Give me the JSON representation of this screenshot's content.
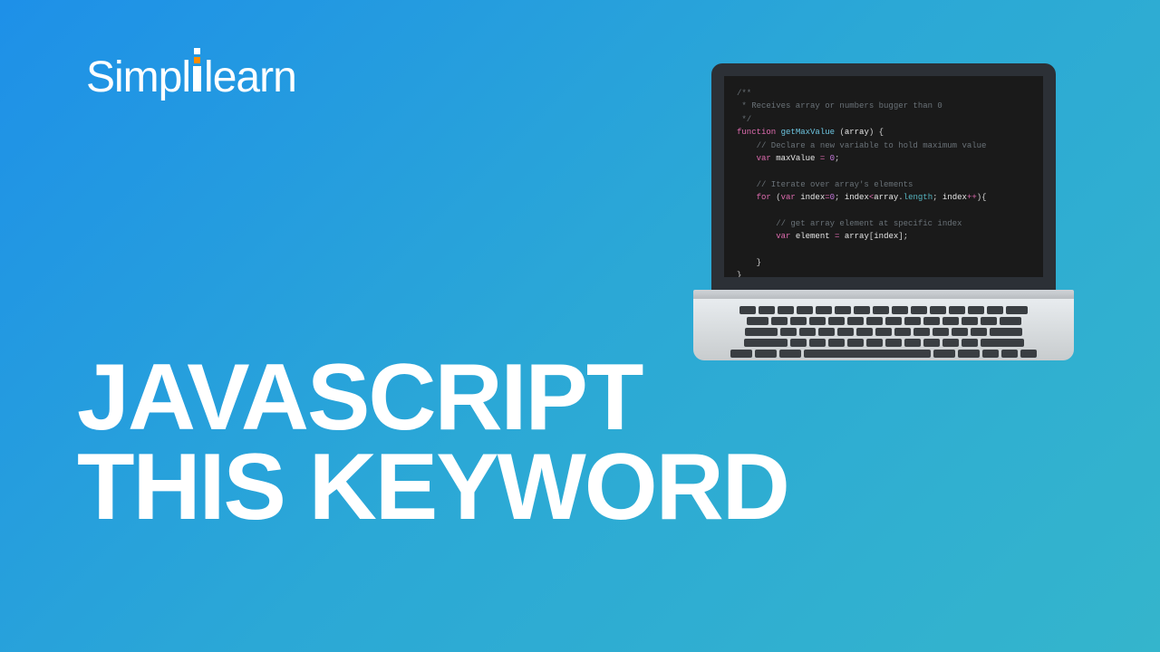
{
  "logo": {
    "part1": "Simpl",
    "part2": "learn"
  },
  "title": {
    "line1": "JAVASCRIPT",
    "line2": "THIS KEYWORD"
  },
  "code": {
    "c1": "/**",
    "c2": " * Receives array or numbers bugger than 0",
    "c3": " */",
    "kw_function": "function",
    "fn_name": " getMaxValue ",
    "paren_open": "(",
    "param": "array",
    "paren_close": ")",
    "brace_open": " {",
    "c4": "    // Declare a new variable to hold maximum value",
    "indent4": "    ",
    "kw_var": "var",
    "var_max": " maxValue ",
    "eq": "= ",
    "zero": "0",
    "semi": ";",
    "c5": "    // Iterate over array's elements",
    "kw_for": "for ",
    "var_index": " index",
    "op_eq": "=",
    "op_lt": "<",
    "dot": ".",
    "prop_length": "length",
    "sep": "; ",
    "op_inc": "++",
    "for_close": "){",
    "c6": "        // get array element at specific index",
    "indent8": "        ",
    "var_elem": " element ",
    "bracket_open": "[",
    "bracket_close": "]",
    "brace_close_inner": "    }",
    "brace_close": "}"
  }
}
